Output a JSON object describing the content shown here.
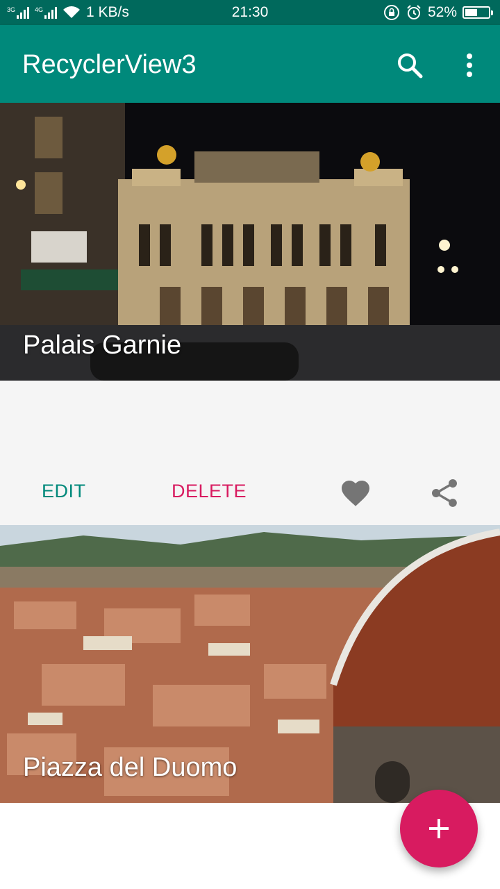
{
  "status_bar": {
    "net_left": "3G",
    "net_right": "4G",
    "speed": "1 KB/s",
    "time": "21:30",
    "battery": "52%",
    "battery_level": 0.52
  },
  "app_bar": {
    "title": "RecyclerView3",
    "icons": [
      "search-icon",
      "more-vert-icon"
    ]
  },
  "cards": [
    {
      "title": "Palais Garnie",
      "actions": {
        "edit": "EDIT",
        "delete": "DELETE"
      },
      "icons": [
        "heart-icon",
        "share-icon"
      ]
    },
    {
      "title": "Piazza del Duomo"
    }
  ],
  "fab": {
    "icon": "plus-icon"
  },
  "colors": {
    "status_bar": "#00695c",
    "primary": "#00897b",
    "accent": "#d81b60",
    "card_bg": "#f5f5f5"
  }
}
